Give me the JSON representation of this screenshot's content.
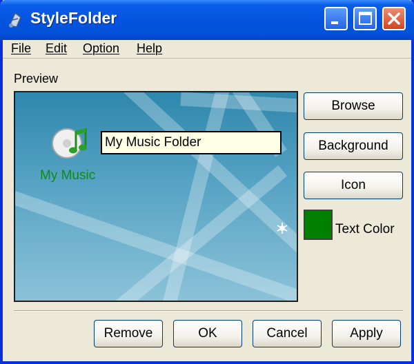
{
  "window": {
    "title": "StyleFolder",
    "icon": "app-icon",
    "buttons": [
      "minimize-icon",
      "maximize-icon",
      "close-icon"
    ]
  },
  "menu": [
    "File",
    "Edit",
    "Option",
    "Help"
  ],
  "preview": {
    "label": "Preview",
    "folder_name": "My Music",
    "rename_value": "My Music Folder",
    "icon": "music-folder-icon"
  },
  "side_buttons": {
    "browse": "Browse",
    "background": "Background",
    "icon": "Icon"
  },
  "text_color": {
    "label": "Text Color",
    "value": "#008000"
  },
  "bottom_buttons": {
    "remove": "Remove",
    "ok": "OK",
    "cancel": "Cancel",
    "apply": "Apply"
  },
  "colors": {
    "title_bar": "#0454e0",
    "dialog_bg": "#ece9d8",
    "folder_text": "#0f8a17",
    "rename_bg": "#ffffe6"
  }
}
